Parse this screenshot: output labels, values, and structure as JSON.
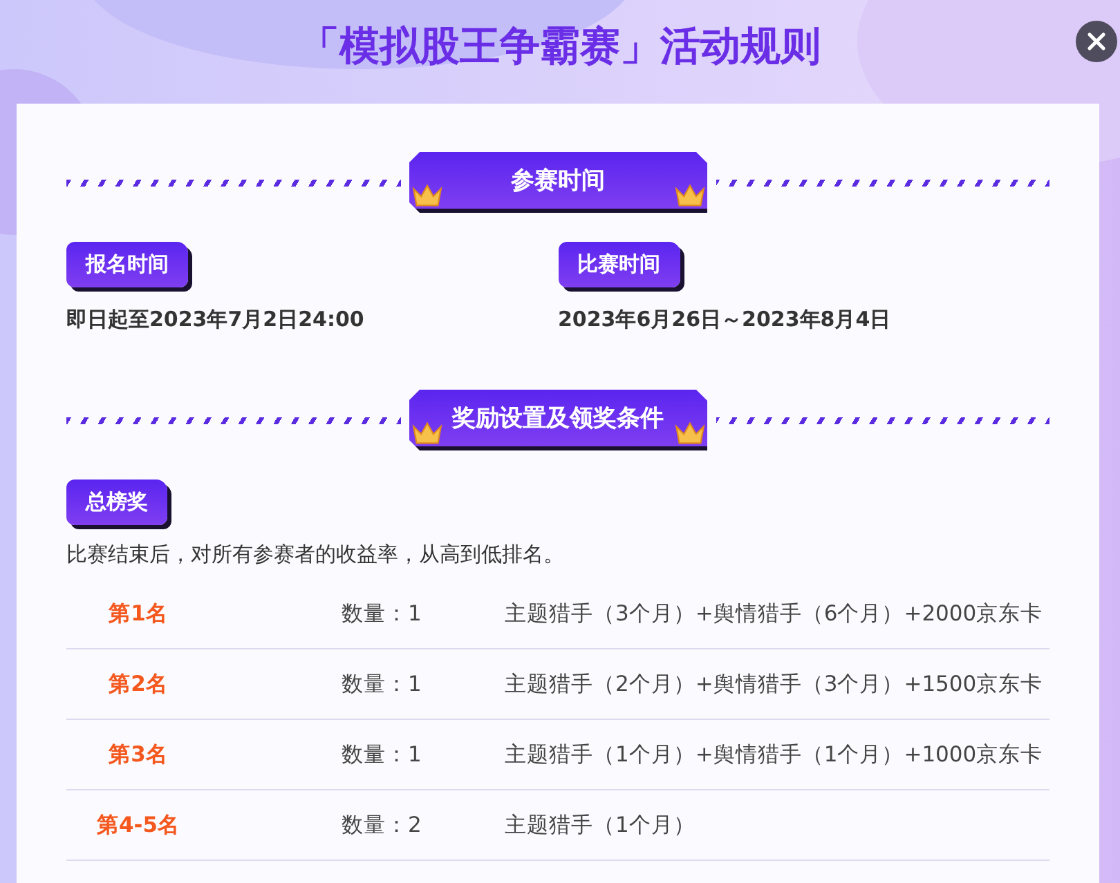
{
  "title": "「模拟股王争霸赛」活动规则",
  "sections": [
    {
      "heading": "参赛时间",
      "kind": "times",
      "items": [
        {
          "tag": "报名时间",
          "text": "即日起至2023年7月2日24:00"
        },
        {
          "tag": "比赛时间",
          "text": "2023年6月26日～2023年8月4日"
        }
      ]
    },
    {
      "heading": "奖励设置及领奖条件",
      "kind": "prizes",
      "tag": "总榜奖",
      "description": "比赛结束后，对所有参赛者的收益率，从高到低排名。",
      "rows": [
        {
          "rank": "第1名",
          "quantity": "数量：1",
          "prize": "主题猎手（3个月）+舆情猎手（6个月）+2000京东卡"
        },
        {
          "rank": "第2名",
          "quantity": "数量：1",
          "prize": "主题猎手（2个月）+舆情猎手（3个月）+1500京东卡"
        },
        {
          "rank": "第3名",
          "quantity": "数量：1",
          "prize": "主题猎手（1个月）+舆情猎手（1个月）+1000京东卡"
        },
        {
          "rank": "第4-5名",
          "quantity": "数量：2",
          "prize": "主题猎手（1个月）"
        }
      ]
    }
  ]
}
